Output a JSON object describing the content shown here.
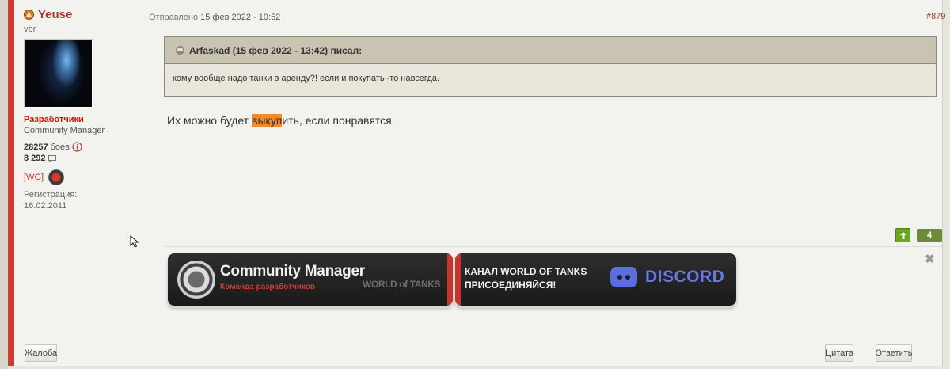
{
  "author": {
    "name": "Yeuse",
    "subtitle": "vbr",
    "group": "Разработчики",
    "role": "Community Manager",
    "battles_count": "28257",
    "battles_label": "боев",
    "posts_count": "8 292",
    "clan_tag": "[WG]",
    "registration_label": "Регистрация:",
    "registration_date": "16.02.2011"
  },
  "post": {
    "sent_label": "Отправлено",
    "date": "15 фев 2022 - 10:52",
    "number": "#879",
    "quote_header": "Arfaskad (15 фев 2022 - 13:42) писал:",
    "quote_text": "кому вообще надо танки в аренду?! если и покупать -то навсегда.",
    "text_before": "Их можно будет ",
    "text_highlight": "выкуп",
    "text_after": "ить, если понравятся.",
    "vote_count": "4"
  },
  "signature": {
    "cm_title": "Community Manager",
    "cm_subtitle": "Команда разработчиков",
    "cm_logo_text": "WORLD of TANKS",
    "discord_line1": "КАНАЛ WORLD OF TANKS",
    "discord_line2": "ПРИСОЕДИНЯЙСЯ!",
    "discord_word": "DISCORD"
  },
  "buttons": {
    "report": "Жалоба",
    "quote": "Цитата",
    "reply": "Ответить"
  },
  "colors": {
    "accent_red": "#cf3a33",
    "author_name": "#a8372e",
    "group_red": "#d1120a",
    "highlight": "#f28a2c",
    "vote_green": "#69a81c"
  }
}
